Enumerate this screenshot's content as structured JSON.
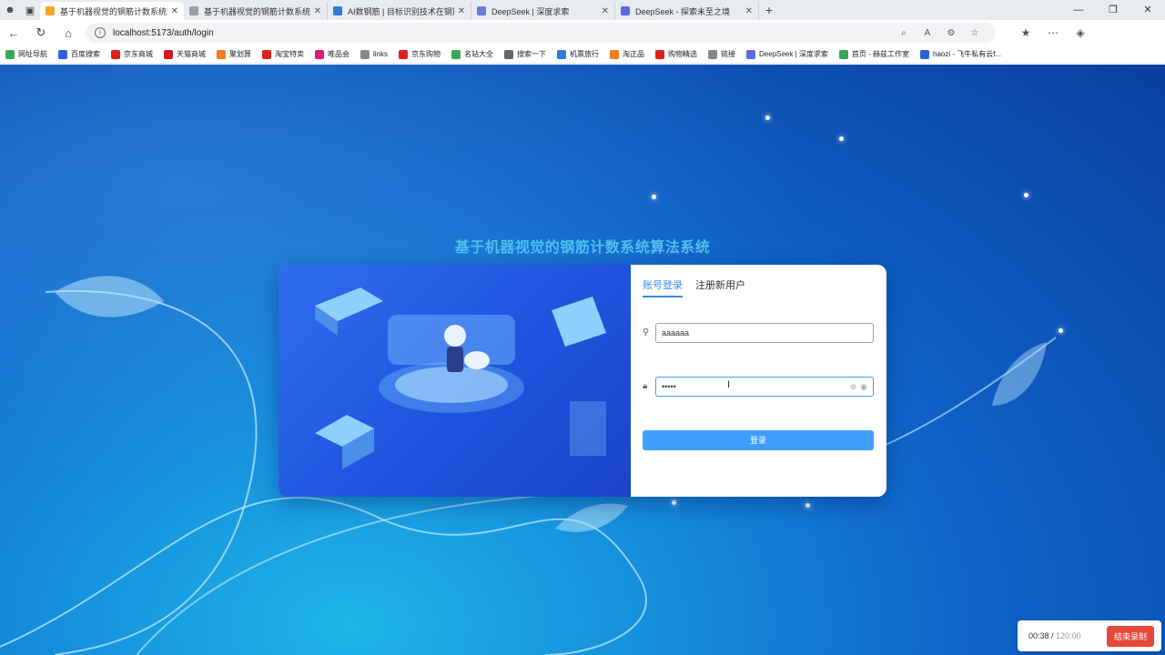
{
  "tabs": [
    {
      "label": "基于机器视觉的钢筋计数系统算法",
      "color": "#f5a623",
      "active": true
    },
    {
      "label": "基于机器视觉的钢筋计数系统算法",
      "color": "#9aa0a6",
      "active": false
    },
    {
      "label": "AI数钢筋 | 目标识别技术在钢筋计",
      "color": "#2f7be0",
      "active": false
    },
    {
      "label": "DeepSeek | 深度求索",
      "color": "#6a7bd9",
      "active": false
    },
    {
      "label": "DeepSeek - 探索未至之境",
      "color": "#5b6ae0",
      "active": false
    }
  ],
  "address": {
    "url": "localhost:5173/auth/login"
  },
  "bookmarks": [
    {
      "label": "网址导航",
      "color": "#3aa757"
    },
    {
      "label": "百度搜索",
      "color": "#2f5fe0"
    },
    {
      "label": "京东商城",
      "color": "#e0201e"
    },
    {
      "label": "天猫商城",
      "color": "#d8132c"
    },
    {
      "label": "聚划算",
      "color": "#f57b20"
    },
    {
      "label": "淘宝特卖",
      "color": "#e0201e"
    },
    {
      "label": "唯品会",
      "color": "#e0197d"
    },
    {
      "label": "links",
      "color": "#888888"
    },
    {
      "label": "京东购物",
      "color": "#e0201e"
    },
    {
      "label": "名站大全",
      "color": "#3aa757"
    },
    {
      "label": "搜索一下",
      "color": "#666666"
    },
    {
      "label": "机票旅行",
      "color": "#2f7be0"
    },
    {
      "label": "淘正品",
      "color": "#f57b20"
    },
    {
      "label": "购物精选",
      "color": "#e0201e"
    },
    {
      "label": "链接",
      "color": "#888888"
    },
    {
      "label": "DeepSeek | 深度求索",
      "color": "#5b6ae0"
    },
    {
      "label": "首页 - 赫兹工作室",
      "color": "#3aa757"
    },
    {
      "label": "haozi - 飞牛私有云f...",
      "color": "#2f5fe0"
    }
  ],
  "page": {
    "title": "基于机器视觉的钢筋计数系统算法系统",
    "tab_login": "账号登录",
    "tab_register": "注册新用户",
    "username_value": "aaaaaa",
    "password_value": "•••••",
    "login_button": "登录"
  },
  "recorder": {
    "elapsed": "00:38",
    "total": "120:00",
    "stop_label": "结束录制"
  },
  "colors": {
    "accent": "#409eff",
    "title": "#4fc0ef",
    "stop": "#e8483b"
  }
}
